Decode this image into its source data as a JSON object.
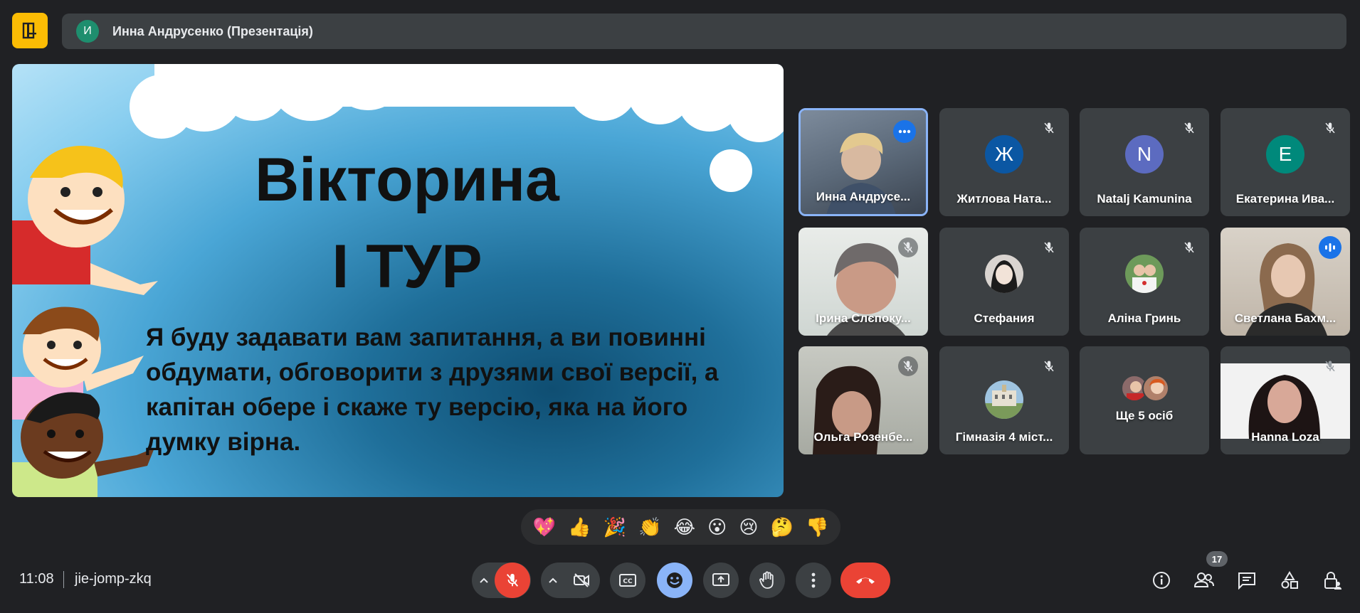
{
  "app": {
    "logo_icon": "meet-logo-icon",
    "accent": "#fbbc04"
  },
  "presenter": {
    "initial": "И",
    "label": "Инна Андрусенко (Презентація)"
  },
  "slide": {
    "title_line1": "Вікторина",
    "title_line2": "І ТУР",
    "body": "Я буду задавати вам запитання, а ви повинні обдумати, обговорити з друзями свої версії, а капітан обере і скаже ту версію, яка на його думку вірна."
  },
  "participants": [
    {
      "name": "Инна Андрусе...",
      "type": "video",
      "active": true
    },
    {
      "name": "Житлова Ната...",
      "initial": "Ж",
      "color": "#0b57a3",
      "type": "avatar",
      "muted": true
    },
    {
      "name": "Natalj Kamunina",
      "initial": "N",
      "color": "#5c6bc0",
      "type": "avatar",
      "muted": true
    },
    {
      "name": "Екатерина Ива...",
      "initial": "Е",
      "color": "#00897b",
      "type": "avatar",
      "muted": true
    },
    {
      "name": "Ірина Слєпоку...",
      "type": "video",
      "muted": true
    },
    {
      "name": "Стефания",
      "type": "photo",
      "muted": true
    },
    {
      "name": "Аліна Гринь",
      "type": "photo",
      "muted": true
    },
    {
      "name": "Светлана Бахм...",
      "type": "video",
      "speaking": true
    },
    {
      "name": "Ольга Розенбе...",
      "type": "video",
      "muted": true
    },
    {
      "name": "Гімназія 4 міст...",
      "type": "photo",
      "muted": true
    },
    {
      "name": "Ще 5 осіб",
      "type": "group"
    },
    {
      "name": "Hanna Loza",
      "type": "video",
      "muted": true
    }
  ],
  "reactions": [
    "💖",
    "👍",
    "🎉",
    "👏",
    "😂",
    "😮",
    "😢",
    "🤔",
    "👎"
  ],
  "footer": {
    "time": "11:08",
    "meeting_code": "jie-jomp-zkq",
    "people_count": "17"
  }
}
